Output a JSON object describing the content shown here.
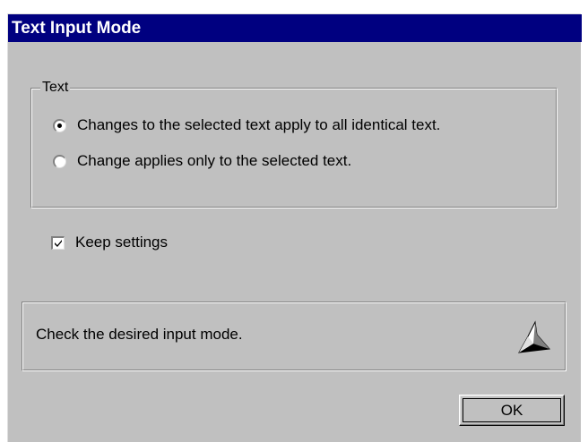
{
  "window": {
    "title": "Text Input Mode"
  },
  "text_group": {
    "legend": "Text",
    "options": [
      {
        "label": "Changes to the selected text apply to all identical text.",
        "checked": true
      },
      {
        "label": "Change applies only to the selected text.",
        "checked": false
      }
    ]
  },
  "keep_settings": {
    "label": "Keep settings",
    "checked": true
  },
  "info": {
    "message": "Check the desired input mode.",
    "icon": "wizard-hat-icon"
  },
  "buttons": {
    "ok_label": "OK"
  },
  "colors": {
    "titlebar": "#000080",
    "face": "#c0c0c0"
  }
}
